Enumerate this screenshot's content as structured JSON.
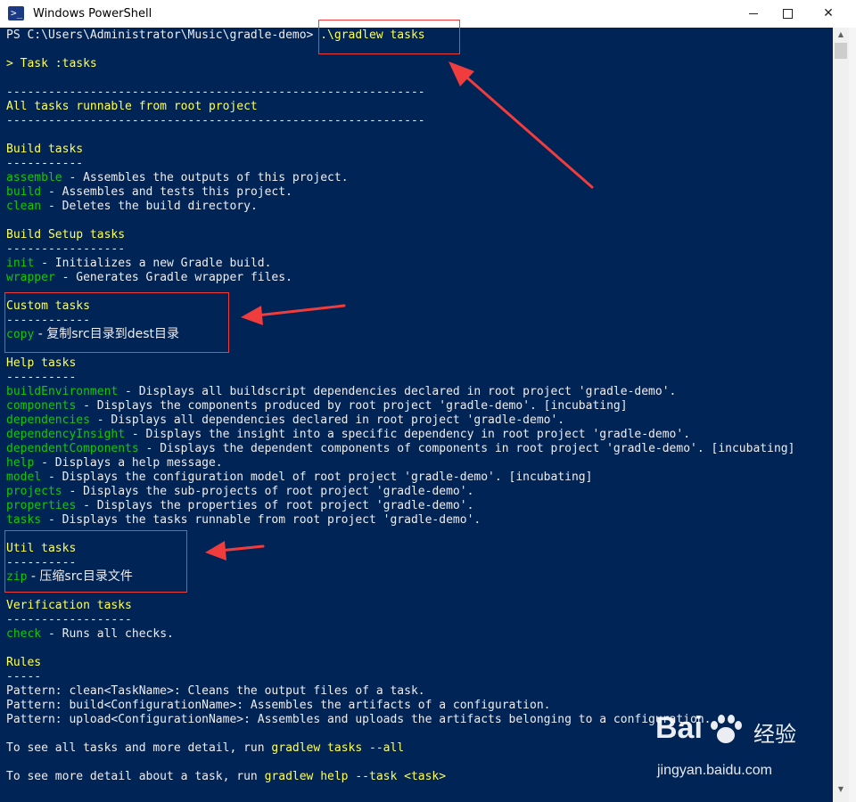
{
  "window": {
    "title": "Windows PowerShell",
    "icon": "powershell-icon",
    "min_symbol": "",
    "close_symbol": "✕"
  },
  "console": {
    "prompt": "PS C:\\Users\\Administrator\\Music\\gradle-demo> ",
    "command": ".\\gradlew tasks",
    "task_line": "> Task :tasks",
    "separator": "------------------------------------------------------------",
    "header": "All tasks runnable from root project",
    "groups": {
      "build": {
        "title": "Build tasks",
        "underline": "-----------",
        "tasks": [
          {
            "name": "assemble",
            "desc": " - Assembles the outputs of this project."
          },
          {
            "name": "build",
            "desc": " - Assembles and tests this project."
          },
          {
            "name": "clean",
            "desc": " - Deletes the build directory."
          }
        ]
      },
      "build_setup": {
        "title": "Build Setup tasks",
        "underline": "-----------------",
        "tasks": [
          {
            "name": "init",
            "desc": " - Initializes a new Gradle build."
          },
          {
            "name": "wrapper",
            "desc": " - Generates Gradle wrapper files."
          }
        ]
      },
      "custom": {
        "title": "Custom tasks",
        "underline": "------------",
        "tasks": [
          {
            "name": "copy",
            "desc": " - 复制src目录到dest目录"
          }
        ]
      },
      "help": {
        "title": "Help tasks",
        "underline": "----------",
        "tasks": [
          {
            "name": "buildEnvironment",
            "desc": " - Displays all buildscript dependencies declared in root project 'gradle-demo'."
          },
          {
            "name": "components",
            "desc": " - Displays the components produced by root project 'gradle-demo'. [incubating]"
          },
          {
            "name": "dependencies",
            "desc": " - Displays all dependencies declared in root project 'gradle-demo'."
          },
          {
            "name": "dependencyInsight",
            "desc": " - Displays the insight into a specific dependency in root project 'gradle-demo'."
          },
          {
            "name": "dependentComponents",
            "desc": " - Displays the dependent components of components in root project 'gradle-demo'. [incubating]"
          },
          {
            "name": "help",
            "desc": " - Displays a help message."
          },
          {
            "name": "model",
            "desc": " - Displays the configuration model of root project 'gradle-demo'. [incubating]"
          },
          {
            "name": "projects",
            "desc": " - Displays the sub-projects of root project 'gradle-demo'."
          },
          {
            "name": "properties",
            "desc": " - Displays the properties of root project 'gradle-demo'."
          },
          {
            "name": "tasks",
            "desc": " - Displays the tasks runnable from root project 'gradle-demo'."
          }
        ]
      },
      "util": {
        "title": "Util tasks",
        "underline": "----------",
        "tasks": [
          {
            "name": "zip",
            "desc": " - 压缩src目录文件"
          }
        ]
      },
      "verification": {
        "title": "Verification tasks",
        "underline": "------------------",
        "tasks": [
          {
            "name": "check",
            "desc": " - Runs all checks."
          }
        ]
      }
    },
    "rules": {
      "title": "Rules",
      "underline": "-----",
      "lines": [
        "Pattern: clean<TaskName>: Cleans the output files of a task.",
        "Pattern: build<ConfigurationName>: Assembles the artifacts of a configuration.",
        "Pattern: upload<ConfigurationName>: Assembles and uploads the artifacts belonging to a configuration."
      ]
    },
    "footer1": {
      "text": "To see all tasks and more detail, run ",
      "cmd": "gradlew tasks --all"
    },
    "footer2": {
      "text": "To see more detail about a task, run ",
      "cmd": "gradlew help --task <task>"
    }
  },
  "watermark": {
    "logo_a": "Bai",
    "logo_b": "经验",
    "url": "jingyan.baidu.com"
  },
  "colors": {
    "console_bg": "#012456",
    "heading": "#ffff55",
    "task_name": "#16c60c",
    "text": "#eeedf0",
    "annotation": "#f03c3c"
  }
}
